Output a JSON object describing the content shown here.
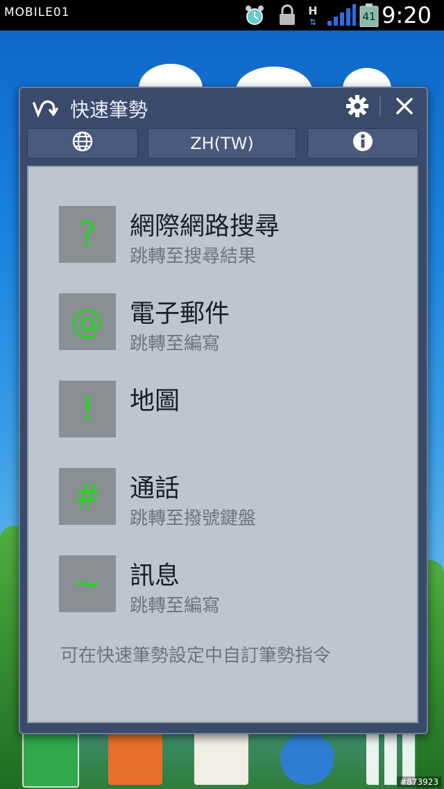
{
  "statusbar": {
    "brand": "MOBILE01",
    "icons": [
      "alarm-icon",
      "lock-icon",
      "network-h-icon",
      "signal-icon",
      "battery-icon"
    ],
    "battery": "41",
    "network_type": "H",
    "time": "9:20"
  },
  "dialog": {
    "title": "快速筆勢",
    "tabs": {
      "language": "ZH(TW)"
    },
    "items": [
      {
        "symbol": "?",
        "title": "網際網路搜尋",
        "subtitle": "跳轉至搜尋結果"
      },
      {
        "symbol": "@",
        "title": "電子郵件",
        "subtitle": "跳轉至編寫"
      },
      {
        "symbol": "!",
        "title": "地圖",
        "subtitle": ""
      },
      {
        "symbol": "#",
        "title": "通話",
        "subtitle": "跳轉至撥號鍵盤"
      },
      {
        "symbol": "~",
        "title": "訊息",
        "subtitle": "跳轉至編寫"
      }
    ],
    "hint": "可在快速筆勢設定中自訂筆勢指令"
  },
  "watermark": "#873923",
  "colors": {
    "gesture_symbol": "#23d41f",
    "dialog_bg": "#3a4a6b",
    "content_bg": "#bec6cd"
  }
}
